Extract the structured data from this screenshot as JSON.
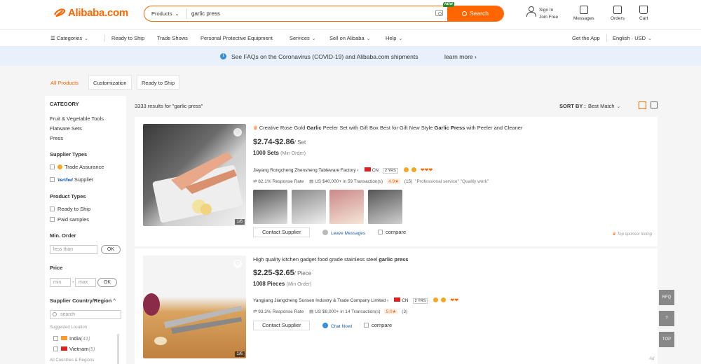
{
  "header": {
    "logo": "Alibaba.com",
    "search_category": "Products",
    "search_value": "garlic press",
    "search_button": "Search",
    "new_badge": "NEW",
    "sign_in": "Sign In",
    "join_free": "Join Free",
    "messages": "Messages",
    "orders": "Orders",
    "cart": "Cart"
  },
  "nav": {
    "categories": "Categories",
    "items": [
      "Ready to Ship",
      "Trade Shows",
      "Personal Protective Equipment",
      "Services",
      "Sell on Alibaba",
      "Help"
    ],
    "get_app": "Get the App",
    "language": "English · USD"
  },
  "banner": {
    "text": "See FAQs on the Coronavirus (COVID-19) and Alibaba.com shipments",
    "link": "learn more"
  },
  "product_tabs": [
    "All Products",
    "Customization",
    "Ready to Ship"
  ],
  "sidebar": {
    "category_title": "CATEGORY",
    "categories": [
      "Fruit & Vegetable Tools",
      "Flatware Sets",
      "Press"
    ],
    "supplier_types_title": "Supplier Types",
    "trade_assurance": "Trade Assurance",
    "verified": "Verified",
    "supplier": "Supplier",
    "product_types_title": "Product Types",
    "ready_to_ship": "Ready to Ship",
    "paid_samples": "Paid samples",
    "min_order_title": "Min. Order",
    "less_than": "less than",
    "ok": "OK",
    "price_title": "Price",
    "min": "min",
    "dash": "-",
    "max": "max",
    "country_title": "Supplier Country/Region",
    "country_search": "search",
    "suggested": "Suggested Location",
    "countries": [
      {
        "name": "India",
        "count": "(41)"
      },
      {
        "name": "Vietnam",
        "count": "(5)"
      }
    ],
    "all_countries": "All Countries & Regions"
  },
  "results": {
    "count_text": "3333 results for \"garlic press\"",
    "sort_label": "SORT BY :",
    "sort_value": "Best Match"
  },
  "products": [
    {
      "title_pre": "Creative Rose Gold ",
      "title_b1": "Garlic",
      "title_mid": " Peeler Set with Gift Box Best for Gift New Style ",
      "title_b2": "Garlic Press",
      "title_post": " with Peeler and Cleaner",
      "price": "$2.74-$2.86",
      "unit": "/ Set",
      "moq": "1000 Sets",
      "moq_note": "(Min Order)",
      "supplier": "Jieyang Rongcheng Zhensheng Tableware Factory",
      "country": "CN",
      "years": "2 YRS",
      "response": "82.1% Response Rate",
      "transactions": "US $40,000+ in 59 Transaction(s)",
      "rating": "4.9★",
      "reviews": "(15)",
      "review_tags": "\"Professional service\"  \"Quality work\"",
      "image_count": "1/6",
      "contact": "Contact Supplier",
      "message": "Leave Messages",
      "compare": "compare",
      "sponsor": "Top sponsor listing"
    },
    {
      "title_pre": "High quality kitchen gadget food grade stainless steel ",
      "title_b1": "garlic press",
      "price": "$2.25-$2.65",
      "unit": "/ Piece",
      "moq": "1008 Pieces",
      "moq_note": "(Min Order)",
      "supplier": "Yangjiang Jiangcheng Sunsen Industry & Trade Company Limited",
      "country": "CN",
      "years": "2 YRS",
      "response": "93.3% Response Rate",
      "transactions": "US $8,000+ in 14 Transaction(s)",
      "rating": "5.0★",
      "reviews": "(3)",
      "image_count": "1/6",
      "contact": "Contact Supplier",
      "message": "Chat Now!",
      "compare": "compare"
    }
  ],
  "side_buttons": [
    "RFQ",
    "?",
    "TOP"
  ],
  "ad": "Ad",
  "colors": {
    "accent": "#ff6600",
    "banner": "#e8f1fb"
  }
}
